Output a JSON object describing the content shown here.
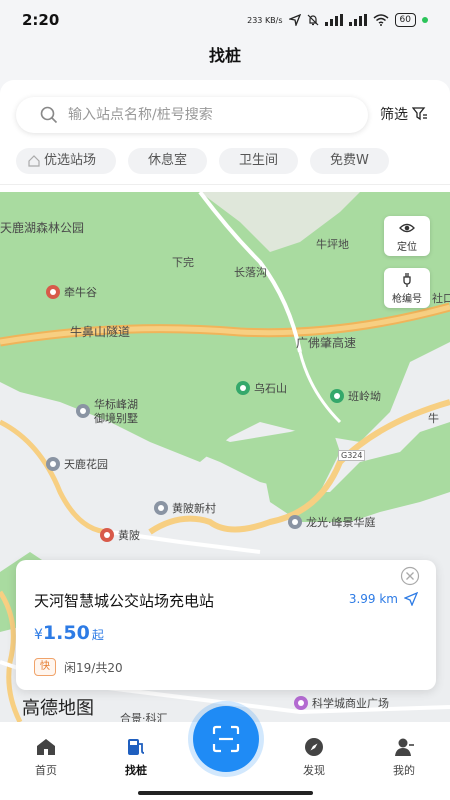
{
  "status_bar": {
    "time": "2:20",
    "net_speed": "233 KB/s",
    "battery": "60"
  },
  "page_title": "找桩",
  "search": {
    "placeholder": "输入站点名称/桩号搜索",
    "filter_label": "筛选"
  },
  "tags": [
    "优选站场",
    "休息室",
    "卫生间",
    "免费W"
  ],
  "map": {
    "labels": {
      "forest_park": "天鹿湖森林公园",
      "niuping": "牛坪地",
      "xiawan": "下完",
      "changluo": "长落沟",
      "tunnel": "牛鼻山隧道",
      "expressway": "广佛肇高速",
      "shekou": "社口",
      "niu_right": "牛",
      "road_g324": "G324",
      "hejing": "合景·科汇"
    },
    "pois": {
      "qianniugu": "牵牛谷",
      "wushishan": "乌石山",
      "banlingao": "班岭坳",
      "huabiao": "华标峰湖\n御境别墅",
      "tianlu_garden": "天鹿花园",
      "huangbei_village": "黄陂新村",
      "huangbei": "黄陂",
      "longguang": "龙光·峰景华庭",
      "science_city": "科学城商业广场"
    },
    "buttons": {
      "locate": "定位",
      "gun_number": "枪编号"
    },
    "logo": "高德地图"
  },
  "station_card": {
    "name": "天河智慧城公交站场充电站",
    "distance": "3.99 km",
    "currency": "¥",
    "price": "1.50",
    "price_suffix": "起",
    "fast_badge": "快",
    "availability": "闲19/共20"
  },
  "tab_bar": {
    "items": [
      {
        "label": "首页",
        "icon": "home-icon"
      },
      {
        "label": "找桩",
        "icon": "charger-icon",
        "active": true
      },
      {
        "label": "发现",
        "icon": "compass-icon"
      },
      {
        "label": "我的",
        "icon": "user-icon"
      }
    ],
    "scan_icon": "scan-icon"
  },
  "colors": {
    "accent": "#2d7be5",
    "scan_button": "#1f8bf5",
    "map_green": "#a9dba0",
    "road_orange": "#f0b45a"
  }
}
